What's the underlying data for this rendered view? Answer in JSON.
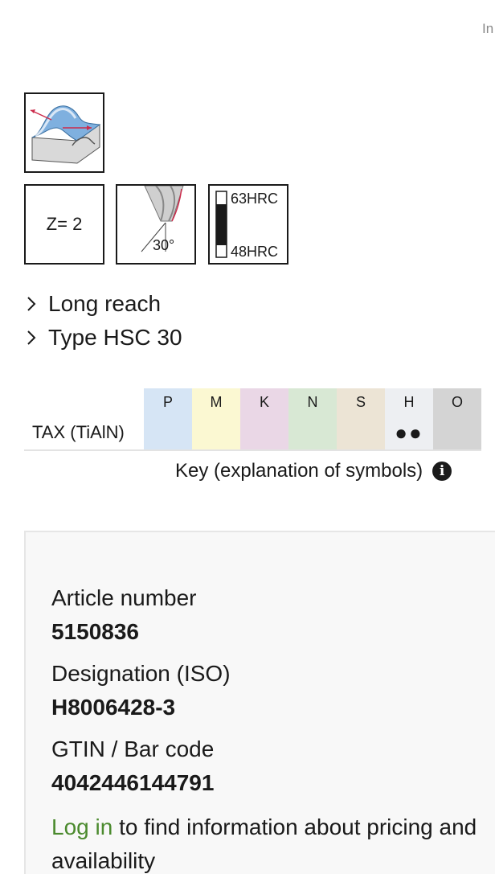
{
  "header": {
    "corner_text": "In"
  },
  "icons": {
    "application": "3d-milling-icon",
    "teeth": {
      "label": "Z= 2"
    },
    "helix": {
      "angle": "30°"
    },
    "hardness": {
      "max": "63HRC",
      "min": "48HRC"
    }
  },
  "links": [
    {
      "label": "Long reach"
    },
    {
      "label": "Type HSC 30"
    }
  ],
  "materials": {
    "columns": [
      {
        "code": "P",
        "color": "#d6e5f5"
      },
      {
        "code": "M",
        "color": "#fbf8d2"
      },
      {
        "code": "K",
        "color": "#ead7e6"
      },
      {
        "code": "N",
        "color": "#d8e8d4"
      },
      {
        "code": "S",
        "color": "#ece4d5"
      },
      {
        "code": "H",
        "color": "#edeff2"
      },
      {
        "code": "O",
        "color": "#d4d4d4"
      }
    ],
    "rows": [
      {
        "coating": "TAX (TiAlN)",
        "cells": [
          "",
          "",
          "",
          "",
          "",
          "●●",
          ""
        ]
      }
    ]
  },
  "key_link": {
    "label": "Key (explanation of symbols)"
  },
  "details": {
    "article_label": "Article number",
    "article_value": "5150836",
    "designation_label": "Designation (ISO)",
    "designation_value": "H8006428-3",
    "gtin_label": "GTIN / Bar code",
    "gtin_value": "4042446144791",
    "login_link": "Log in",
    "login_text": " to find information about pricing and",
    "login_text_2": "availability"
  }
}
